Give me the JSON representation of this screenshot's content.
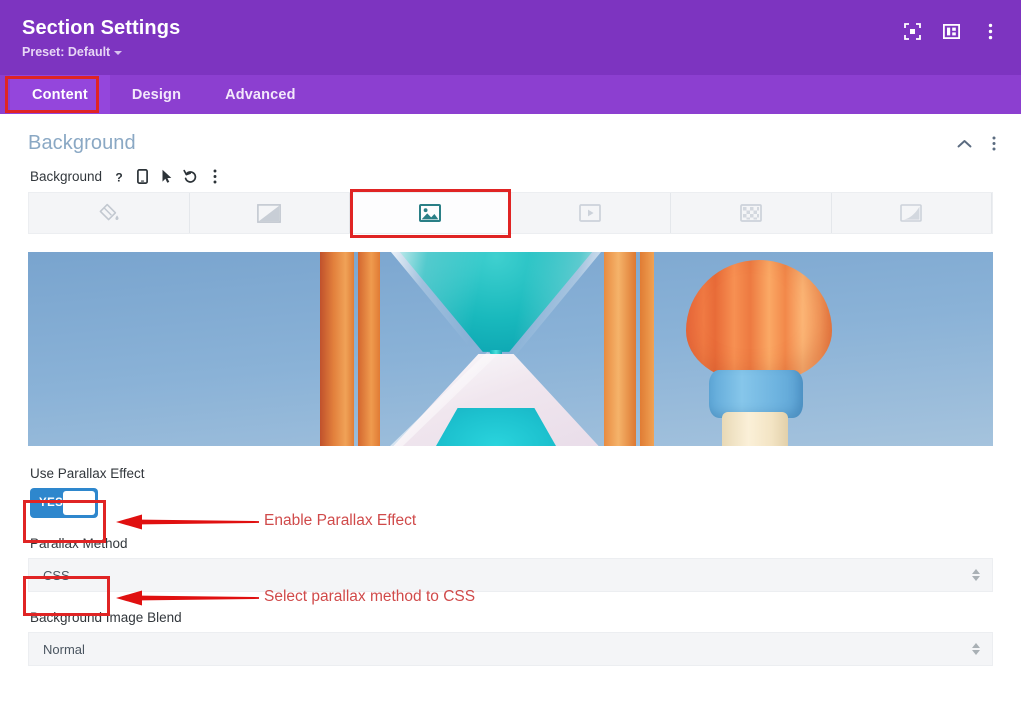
{
  "titlebar": {
    "title": "Section Settings",
    "preset_label": "Preset: Default",
    "icons": [
      {
        "name": "fullscreen-icon",
        "label": "Fullscreen"
      },
      {
        "name": "layout-panel-icon",
        "label": "Layout"
      },
      {
        "name": "more-vertical-icon",
        "label": "More options"
      }
    ]
  },
  "tabs": [
    {
      "label": "Content",
      "active": true
    },
    {
      "label": "Design",
      "active": false
    },
    {
      "label": "Advanced",
      "active": false
    }
  ],
  "section": {
    "title": "Background",
    "collapse_icon": "chevron-up-icon",
    "more_icon": "more-vertical-icon"
  },
  "field": {
    "label": "Background",
    "icons": [
      {
        "name": "help-icon",
        "glyph": "?"
      },
      {
        "name": "responsive-mobile-icon",
        "glyph": "mobile"
      },
      {
        "name": "hover-cursor-icon",
        "glyph": "cursor"
      },
      {
        "name": "reset-undo-icon",
        "glyph": "undo"
      },
      {
        "name": "more-vertical-icon",
        "glyph": "dots"
      }
    ]
  },
  "background_tabs": [
    {
      "name": "background-color-tab",
      "icon": "paint-bucket-icon",
      "active": false
    },
    {
      "name": "background-gradient-tab",
      "icon": "gradient-icon",
      "active": false
    },
    {
      "name": "background-image-tab",
      "icon": "image-icon",
      "active": true
    },
    {
      "name": "background-video-tab",
      "icon": "video-icon",
      "active": false
    },
    {
      "name": "background-pattern-tab",
      "icon": "pattern-icon",
      "active": false
    },
    {
      "name": "background-mask-tab",
      "icon": "mask-icon",
      "active": false
    }
  ],
  "preview": {
    "name": "background-image-preview",
    "description": "Hourglass with teal sand between orange pillars and an orange hot air balloon against a blue sky"
  },
  "controls": {
    "parallax_toggle_label": "Use Parallax Effect",
    "parallax_toggle_value": "YES",
    "parallax_method_label": "Parallax Method",
    "parallax_method_value": "CSS",
    "blend_label": "Background Image Blend",
    "blend_value": "Normal"
  },
  "annotations": [
    {
      "name": "annotation-enable-parallax",
      "text": "Enable Parallax Effect"
    },
    {
      "name": "annotation-select-css",
      "text": "Select parallax method to CSS"
    }
  ],
  "colors": {
    "titlebar_purple": "#7d34c0",
    "tabbar_purple": "#8c3fd0",
    "tab_active_purple": "#9446dc",
    "section_title_blue": "#8aa8c4",
    "toggle_blue": "#2e87cd",
    "annotation_red": "#d04a4a",
    "highlight_red": "#e02424",
    "active_tab_icon_teal": "#2a7f86"
  }
}
